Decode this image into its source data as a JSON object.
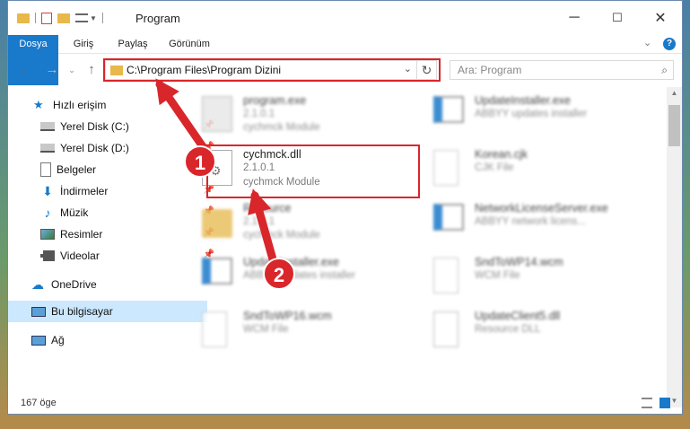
{
  "window": {
    "title": "Program",
    "controls": {
      "minimize": "─",
      "maximize": "☐",
      "close": "✕"
    }
  },
  "ribbon": {
    "tabs": [
      {
        "label": "Dosya",
        "active": true
      },
      {
        "label": "Giriş"
      },
      {
        "label": "Paylaş"
      },
      {
        "label": "Görünüm"
      }
    ],
    "help": "?"
  },
  "navigation": {
    "address_path": "C:\\Program Files\\Program Dizini",
    "search_placeholder": "Ara: Program"
  },
  "sidebar": {
    "items": [
      {
        "label": "Hızlı erişim",
        "icon": "star-icon",
        "pinned": false
      },
      {
        "label": "Yerel Disk (C:)",
        "icon": "drive-icon",
        "pinned": true
      },
      {
        "label": "Yerel Disk (D:)",
        "icon": "drive-icon",
        "pinned": true
      },
      {
        "label": "Belgeler",
        "icon": "documents-icon",
        "pinned": true
      },
      {
        "label": "İndirmeler",
        "icon": "download-icon",
        "pinned": true
      },
      {
        "label": "Müzik",
        "icon": "music-icon",
        "pinned": true
      },
      {
        "label": "Resimler",
        "icon": "pictures-icon",
        "pinned": true
      },
      {
        "label": "Videolar",
        "icon": "videos-icon",
        "pinned": true
      },
      {
        "label": "OneDrive",
        "icon": "cloud-icon"
      },
      {
        "label": "Bu bilgisayar",
        "icon": "computer-icon",
        "selected": true
      },
      {
        "label": "Ağ",
        "icon": "network-icon"
      }
    ]
  },
  "files": [
    {
      "name": "program.exe",
      "line2": "2.1.0.1",
      "line3": "cychmck Module",
      "icon": "exe-icon",
      "blurred": true
    },
    {
      "name": "UpdateInstaller.exe",
      "line2": "ABBYY updates installer",
      "line3": "",
      "icon": "installer-icon",
      "blurred": true
    },
    {
      "name": "cychmck.dll",
      "line2": "2.1.0.1",
      "line3": "cychmck Module",
      "icon": "dll-icon",
      "highlighted": true
    },
    {
      "name": "Korean.cjk",
      "line2": "CJK File",
      "line3": "",
      "icon": "file-icon",
      "blurred": true
    },
    {
      "name": "Resource",
      "line2": "2.1.0.1",
      "line3": "cychmck Module",
      "icon": "folder-icon",
      "blurred": true
    },
    {
      "name": "NetworkLicenseServer.exe",
      "line2": "ABBYY network licens...",
      "line3": "",
      "icon": "installer-icon",
      "blurred": true
    },
    {
      "name": "UpdateInstaller.exe",
      "line2": "ABBYY updates installer",
      "line3": "",
      "icon": "installer-icon",
      "blurred": true
    },
    {
      "name": "SndToWP14.wcm",
      "line2": "WCM File",
      "line3": "",
      "icon": "file-icon",
      "blurred": true
    },
    {
      "name": "SndToWP16.wcm",
      "line2": "WCM File",
      "line3": "",
      "icon": "file-icon",
      "blurred": true
    },
    {
      "name": "UpdateClient5.dll",
      "line2": "Resource DLL",
      "line3": "",
      "icon": "dll-icon",
      "blurred": true
    }
  ],
  "status": {
    "item_count": "167 öge"
  },
  "annotations": {
    "step1": "1",
    "step2": "2"
  },
  "colors": {
    "accent": "#1979ca",
    "highlight": "#d9262b",
    "selected": "#cce8ff"
  }
}
